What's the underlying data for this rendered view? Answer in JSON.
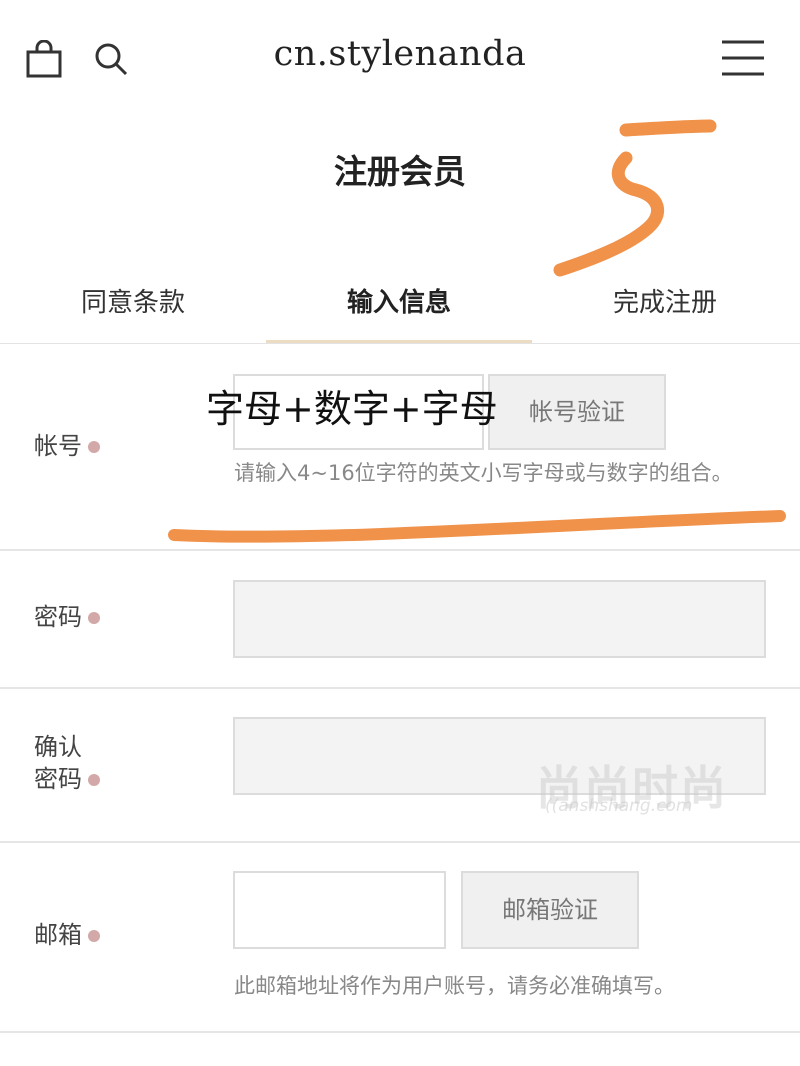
{
  "header": {
    "brand": "cn.stylenanda",
    "icons": [
      "shopping-bag-icon",
      "search-icon",
      "hamburger-menu-icon"
    ]
  },
  "page": {
    "title": "注册会员"
  },
  "steps": {
    "items": [
      "同意条款",
      "输入信息",
      "完成注册"
    ],
    "active_index": 1
  },
  "form": {
    "account": {
      "label": "帐号",
      "value": "",
      "verify_button": "帐号验证",
      "hint": "请输入4~16位字符的英文小写字母或与数字的组合。"
    },
    "password": {
      "label": "密码",
      "value": ""
    },
    "confirm_password": {
      "label_line1": "确认",
      "label_line2": "密码",
      "value": ""
    },
    "email": {
      "label": "邮箱",
      "value": "",
      "verify_button": "邮箱验证",
      "hint": "此邮箱地址将作为用户账号，请务必准确填写。"
    }
  },
  "annotations": {
    "handwritten_number": "5",
    "overlay_text": "字母+数字+字母",
    "stroke_color": "#f0924a"
  },
  "watermark": {
    "text": "尚尚时尚",
    "sub": "((anshshang.com"
  },
  "colors": {
    "required_dot": "#d3a8a8",
    "active_tab_underline": "#ecdcc4",
    "annotation_orange": "#f0924a"
  }
}
